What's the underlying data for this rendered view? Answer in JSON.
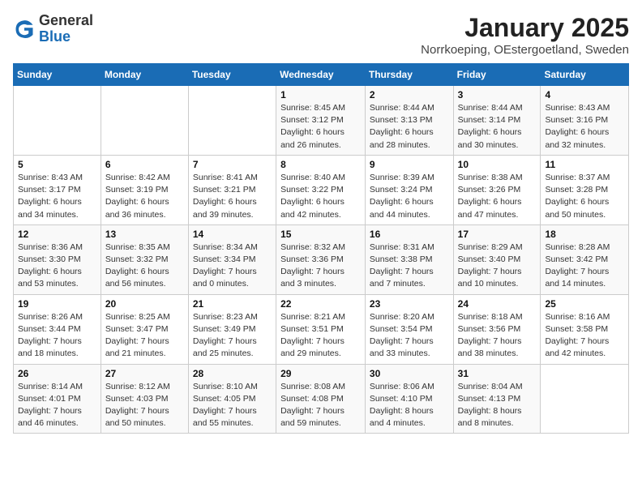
{
  "header": {
    "logo_general": "General",
    "logo_blue": "Blue",
    "month_title": "January 2025",
    "location": "Norrkoeping, OEstergoetland, Sweden"
  },
  "weekdays": [
    "Sunday",
    "Monday",
    "Tuesday",
    "Wednesday",
    "Thursday",
    "Friday",
    "Saturday"
  ],
  "weeks": [
    [
      {
        "day": "",
        "info": ""
      },
      {
        "day": "",
        "info": ""
      },
      {
        "day": "",
        "info": ""
      },
      {
        "day": "1",
        "info": "Sunrise: 8:45 AM\nSunset: 3:12 PM\nDaylight: 6 hours and 26 minutes."
      },
      {
        "day": "2",
        "info": "Sunrise: 8:44 AM\nSunset: 3:13 PM\nDaylight: 6 hours and 28 minutes."
      },
      {
        "day": "3",
        "info": "Sunrise: 8:44 AM\nSunset: 3:14 PM\nDaylight: 6 hours and 30 minutes."
      },
      {
        "day": "4",
        "info": "Sunrise: 8:43 AM\nSunset: 3:16 PM\nDaylight: 6 hours and 32 minutes."
      }
    ],
    [
      {
        "day": "5",
        "info": "Sunrise: 8:43 AM\nSunset: 3:17 PM\nDaylight: 6 hours and 34 minutes."
      },
      {
        "day": "6",
        "info": "Sunrise: 8:42 AM\nSunset: 3:19 PM\nDaylight: 6 hours and 36 minutes."
      },
      {
        "day": "7",
        "info": "Sunrise: 8:41 AM\nSunset: 3:21 PM\nDaylight: 6 hours and 39 minutes."
      },
      {
        "day": "8",
        "info": "Sunrise: 8:40 AM\nSunset: 3:22 PM\nDaylight: 6 hours and 42 minutes."
      },
      {
        "day": "9",
        "info": "Sunrise: 8:39 AM\nSunset: 3:24 PM\nDaylight: 6 hours and 44 minutes."
      },
      {
        "day": "10",
        "info": "Sunrise: 8:38 AM\nSunset: 3:26 PM\nDaylight: 6 hours and 47 minutes."
      },
      {
        "day": "11",
        "info": "Sunrise: 8:37 AM\nSunset: 3:28 PM\nDaylight: 6 hours and 50 minutes."
      }
    ],
    [
      {
        "day": "12",
        "info": "Sunrise: 8:36 AM\nSunset: 3:30 PM\nDaylight: 6 hours and 53 minutes."
      },
      {
        "day": "13",
        "info": "Sunrise: 8:35 AM\nSunset: 3:32 PM\nDaylight: 6 hours and 56 minutes."
      },
      {
        "day": "14",
        "info": "Sunrise: 8:34 AM\nSunset: 3:34 PM\nDaylight: 7 hours and 0 minutes."
      },
      {
        "day": "15",
        "info": "Sunrise: 8:32 AM\nSunset: 3:36 PM\nDaylight: 7 hours and 3 minutes."
      },
      {
        "day": "16",
        "info": "Sunrise: 8:31 AM\nSunset: 3:38 PM\nDaylight: 7 hours and 7 minutes."
      },
      {
        "day": "17",
        "info": "Sunrise: 8:29 AM\nSunset: 3:40 PM\nDaylight: 7 hours and 10 minutes."
      },
      {
        "day": "18",
        "info": "Sunrise: 8:28 AM\nSunset: 3:42 PM\nDaylight: 7 hours and 14 minutes."
      }
    ],
    [
      {
        "day": "19",
        "info": "Sunrise: 8:26 AM\nSunset: 3:44 PM\nDaylight: 7 hours and 18 minutes."
      },
      {
        "day": "20",
        "info": "Sunrise: 8:25 AM\nSunset: 3:47 PM\nDaylight: 7 hours and 21 minutes."
      },
      {
        "day": "21",
        "info": "Sunrise: 8:23 AM\nSunset: 3:49 PM\nDaylight: 7 hours and 25 minutes."
      },
      {
        "day": "22",
        "info": "Sunrise: 8:21 AM\nSunset: 3:51 PM\nDaylight: 7 hours and 29 minutes."
      },
      {
        "day": "23",
        "info": "Sunrise: 8:20 AM\nSunset: 3:54 PM\nDaylight: 7 hours and 33 minutes."
      },
      {
        "day": "24",
        "info": "Sunrise: 8:18 AM\nSunset: 3:56 PM\nDaylight: 7 hours and 38 minutes."
      },
      {
        "day": "25",
        "info": "Sunrise: 8:16 AM\nSunset: 3:58 PM\nDaylight: 7 hours and 42 minutes."
      }
    ],
    [
      {
        "day": "26",
        "info": "Sunrise: 8:14 AM\nSunset: 4:01 PM\nDaylight: 7 hours and 46 minutes."
      },
      {
        "day": "27",
        "info": "Sunrise: 8:12 AM\nSunset: 4:03 PM\nDaylight: 7 hours and 50 minutes."
      },
      {
        "day": "28",
        "info": "Sunrise: 8:10 AM\nSunset: 4:05 PM\nDaylight: 7 hours and 55 minutes."
      },
      {
        "day": "29",
        "info": "Sunrise: 8:08 AM\nSunset: 4:08 PM\nDaylight: 7 hours and 59 minutes."
      },
      {
        "day": "30",
        "info": "Sunrise: 8:06 AM\nSunset: 4:10 PM\nDaylight: 8 hours and 4 minutes."
      },
      {
        "day": "31",
        "info": "Sunrise: 8:04 AM\nSunset: 4:13 PM\nDaylight: 8 hours and 8 minutes."
      },
      {
        "day": "",
        "info": ""
      }
    ]
  ]
}
